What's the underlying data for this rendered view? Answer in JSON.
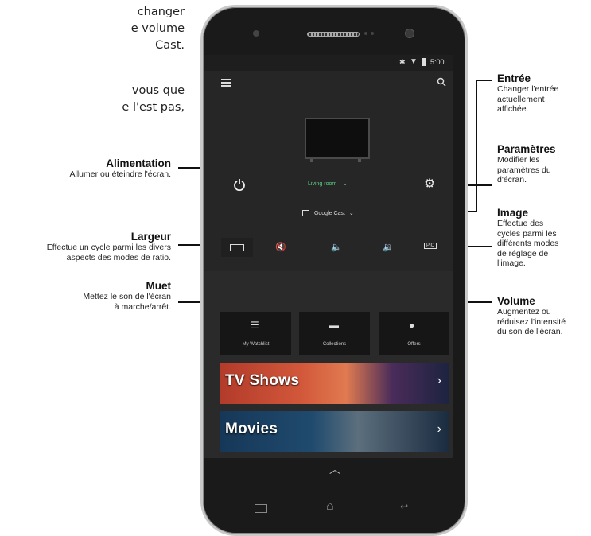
{
  "intro_fragment": {
    "lines1": [
      "changer",
      "e  volume",
      "Cast."
    ],
    "lines2": [
      "vous que",
      "e l'est pas,"
    ]
  },
  "annotations": {
    "power": {
      "title": "Alimentation",
      "desc": "Allumer ou éteindre l'écran."
    },
    "width": {
      "title": "Largeur",
      "desc1": "Effectue un cycle parmi les divers",
      "desc2": "aspects des modes de ratio."
    },
    "mute": {
      "title": "Muet",
      "desc1": "Mettez le son de l'écran",
      "desc2": "à marche/arrêt."
    },
    "input": {
      "title": "Entrée",
      "desc1": "Changer l'entrée",
      "desc2": "actuellement",
      "desc3": "affichée."
    },
    "settings": {
      "title": "Paramètres",
      "desc1": "Modifier les",
      "desc2": "paramètres du",
      "desc3": "d'écran."
    },
    "picture": {
      "title": "Image",
      "desc1": "Effectue des",
      "desc2": "cycles parmi les",
      "desc3": "différents modes",
      "desc4": "de réglage de",
      "desc5": "l'image."
    },
    "volume": {
      "title": "Volume",
      "desc1": "Augmentez ou",
      "desc2": "réduisez l'intensité",
      "desc3": "du son de l'écran."
    }
  },
  "phone": {
    "status_time": "5:00",
    "room_label": "Living room",
    "input_label": "Google Cast",
    "pic_label": "PIC",
    "tiles": [
      "My Watchlist",
      "Collections",
      "Offers"
    ],
    "banners": [
      "TV Shows",
      "Movies"
    ],
    "icons": [
      "menu-icon",
      "search-icon",
      "power-icon",
      "gear-icon",
      "input-icon",
      "aspect-ratio-icon",
      "mute-icon",
      "volume-down-icon",
      "volume-up-icon",
      "watchlist-icon",
      "collections-icon",
      "offers-icon",
      "home-icon",
      "back-icon",
      "recents-icon",
      "bluetooth-icon",
      "wifi-icon",
      "battery-icon"
    ]
  }
}
